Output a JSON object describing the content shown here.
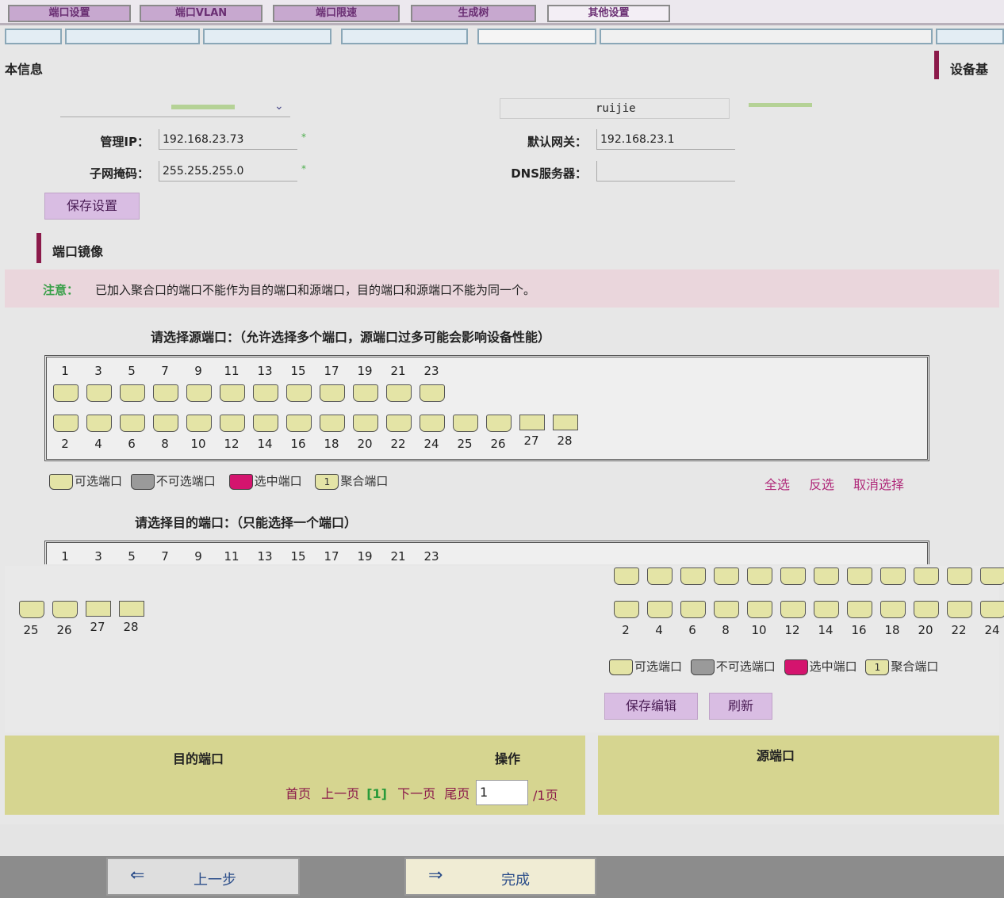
{
  "tabs": [
    "端口设置",
    "端口VLAN",
    "端口限速",
    "生成树",
    "其他设置"
  ],
  "basic_info": {
    "title": "本信息",
    "title_right": "设备基",
    "hostname_value": "ruijie",
    "mgmt_ip_label": "管理IP：",
    "mgmt_ip_value": "192.168.23.73",
    "gateway_label": "默认网关：",
    "gateway_value": "192.168.23.1",
    "mask_label": "子网掩码：",
    "mask_value": "255.255.255.0",
    "dns_label": "DNS服务器：",
    "dns_value": "",
    "required_mark": "*",
    "save_label": "保存设置"
  },
  "mirror": {
    "title": "端口镜像",
    "note_label": "注意：",
    "note_text": "已加入聚合口的端口不能作为目的端口和源端口，目的端口和源端口不能为同一个。",
    "source_prompt": "请选择源端口：（允许选择多个端口，源端口过多可能会影响设备性能）",
    "dest_prompt": "请选择目的端口：（只能选择一个端口）",
    "odd_ports": [
      "1",
      "3",
      "5",
      "7",
      "9",
      "11",
      "13",
      "15",
      "17",
      "19",
      "21",
      "23"
    ],
    "even_ports": [
      "2",
      "4",
      "6",
      "8",
      "10",
      "12",
      "14",
      "16",
      "18",
      "20",
      "22",
      "24",
      "25",
      "26"
    ],
    "extra_ports": [
      "27",
      "28"
    ],
    "lower_left_ports": [
      "25",
      "26",
      "27",
      "28"
    ],
    "lower_right_ports": [
      "2",
      "4",
      "6",
      "8",
      "10",
      "12",
      "14",
      "16",
      "18",
      "20",
      "22",
      "24"
    ],
    "legend": {
      "available": "可选端口",
      "unavailable": "不可选端口",
      "selected": "选中端口",
      "aggregate": "聚合端口",
      "aggregate_num": "1"
    },
    "select_all": "全选",
    "invert": "反选",
    "cancel_select": "取消选择",
    "save_edit": "保存编辑",
    "refresh": "刷新"
  },
  "table": {
    "col_dest": "目的端口",
    "col_op": "操作",
    "col_src": "源端口"
  },
  "pager": {
    "first": "首页",
    "prev": "上一页",
    "current": "[1]",
    "next": "下一页",
    "last": "尾页",
    "page_input": "1",
    "total": "/1页"
  },
  "nav": {
    "prev_label": "上一步",
    "finish_label": "完成"
  },
  "colors": {
    "accent": "#8b1a4a",
    "port_available": "#e4e4a6",
    "port_selected": "#d4146e",
    "port_unavailable": "#9a9a9a"
  }
}
